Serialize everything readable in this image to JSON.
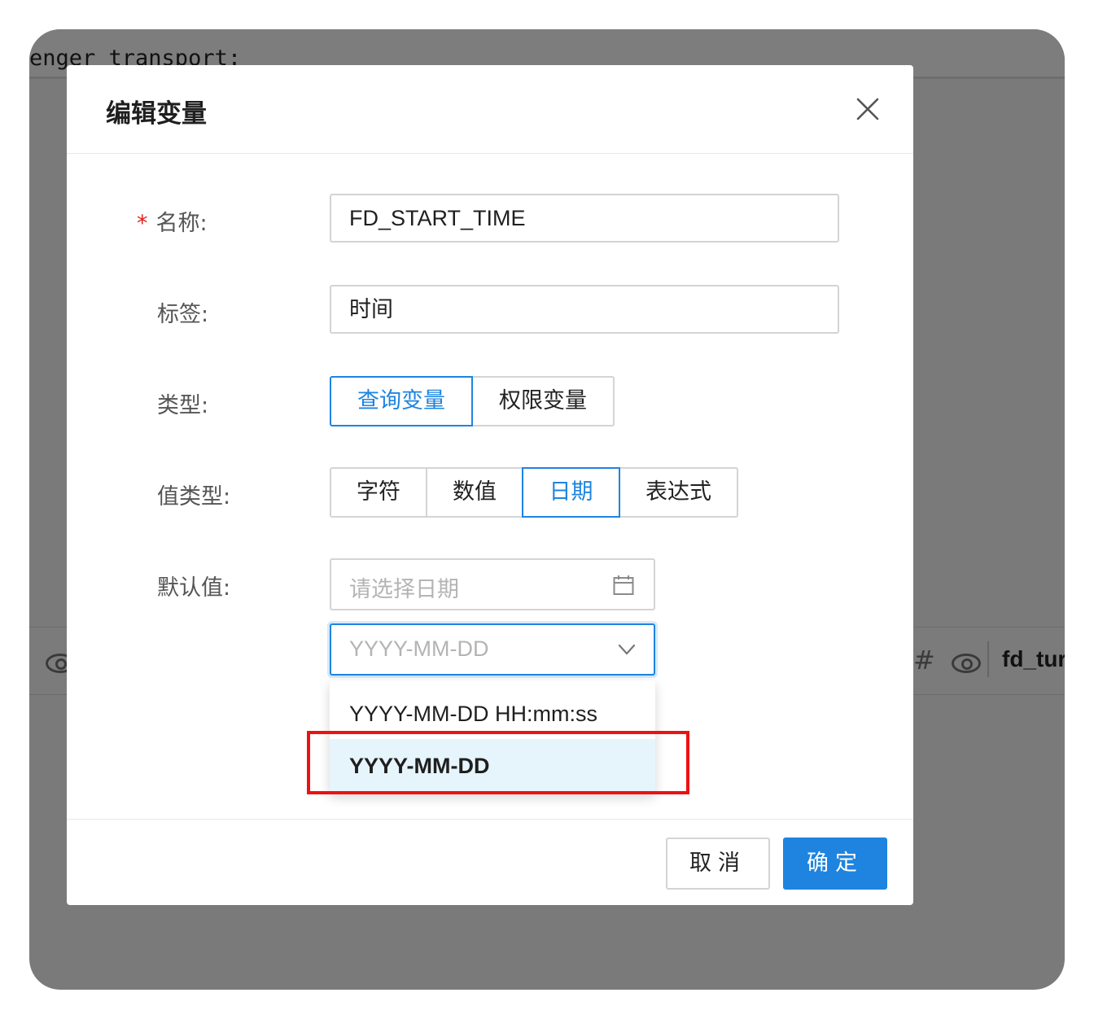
{
  "background": {
    "code_text": "enger transport:",
    "row_text": "fd_tur"
  },
  "dialog": {
    "title": "编辑变量"
  },
  "form": {
    "name": {
      "required_mark": "*",
      "label": "名称:",
      "value": "FD_START_TIME"
    },
    "tag": {
      "label": "标签:",
      "value": "时间"
    },
    "type": {
      "label": "类型:",
      "options": [
        "查询变量",
        "权限变量"
      ],
      "selected": "查询变量"
    },
    "value_type": {
      "label": "值类型:",
      "options": [
        "字符",
        "数值",
        "日期",
        "表达式"
      ],
      "selected": "日期"
    },
    "default_value": {
      "label": "默认值:",
      "placeholder": "请选择日期"
    },
    "date_format": {
      "placeholder": "YYYY-MM-DD",
      "options": [
        "YYYY-MM-DD HH:mm:ss",
        "YYYY-MM-DD"
      ],
      "highlighted": "YYYY-MM-DD"
    }
  },
  "footer": {
    "cancel_label": "取消",
    "ok_label": "确定"
  },
  "colors": {
    "accent": "#1e84e0",
    "highlight_border": "#ee1111",
    "selected_option_bg": "#e6f4fb",
    "overlay": "#7a7a7a"
  }
}
